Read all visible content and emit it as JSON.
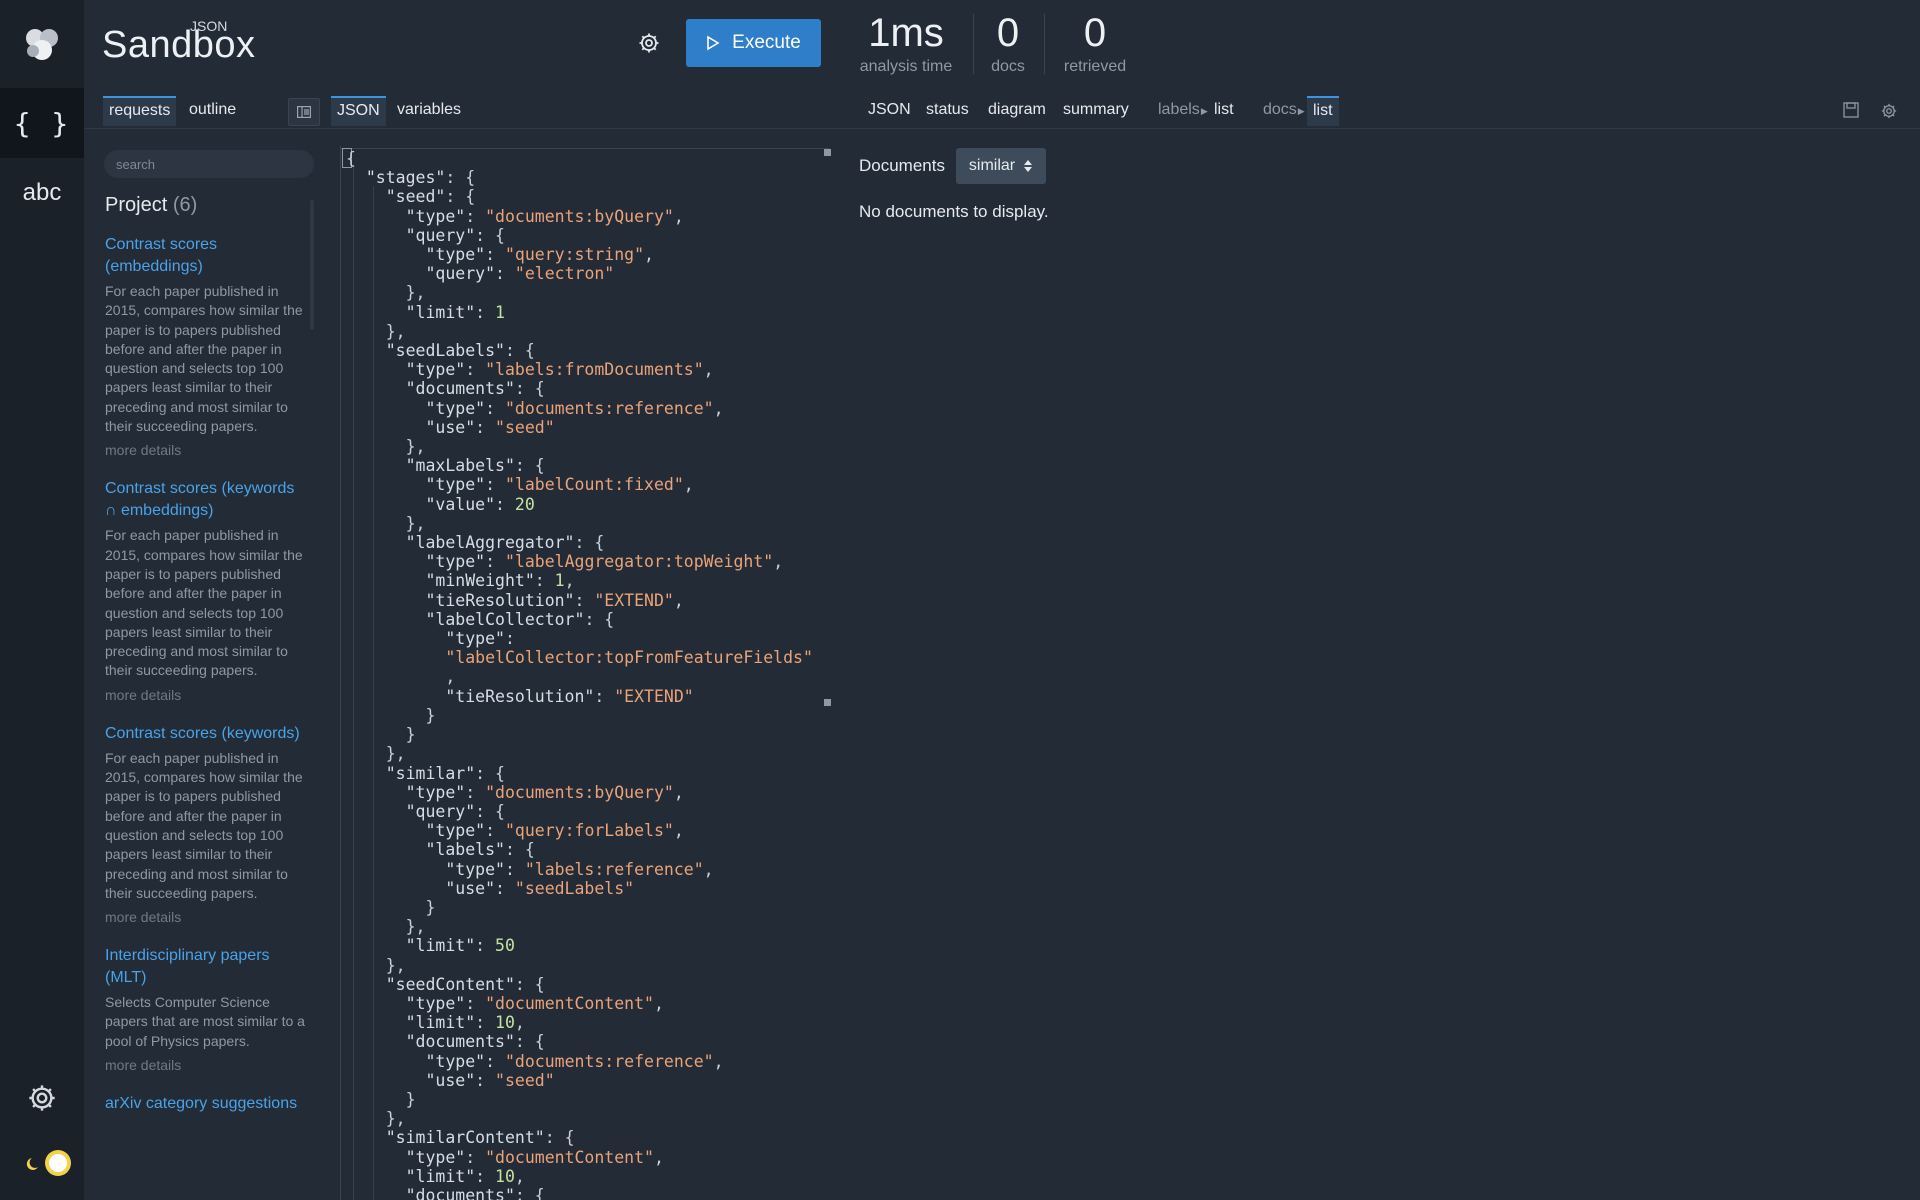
{
  "app": {
    "brand_small": "JSON",
    "brand_big": "Sandbox",
    "execute_label": "Execute"
  },
  "stats": [
    {
      "value": "1ms",
      "label": "analysis time"
    },
    {
      "value": "0",
      "label": "docs"
    },
    {
      "value": "0",
      "label": "retrieved"
    }
  ],
  "left_tabs": {
    "requests": "requests",
    "outline": "outline"
  },
  "editor_tabs": {
    "json": "JSON",
    "variables": "variables"
  },
  "result_tabs": {
    "json": "JSON",
    "status": "status",
    "diagram": "diagram",
    "summary": "summary",
    "labels": "labels",
    "labels_list": "list",
    "docs": "docs",
    "docs_list": "list"
  },
  "rail": {
    "json_icon": "{ }",
    "abc": "abc"
  },
  "sidebar": {
    "search_placeholder": "search",
    "project_title": "Project",
    "project_count": "(6)",
    "items": [
      {
        "title": "Contrast scores (embeddings)",
        "desc": "For each paper published in 2015, compares how similar the paper is to papers published before and after the paper in question and selects top 100 papers least similar to their preceding and most similar to their succeeding papers.",
        "more": "more details"
      },
      {
        "title": "Contrast scores (keywords ∩ embeddings)",
        "desc": "For each paper published in 2015, compares how similar the paper is to papers published before and after the paper in question and selects top 100 papers least similar to their preceding and most similar to their succeeding papers.",
        "more": "more details"
      },
      {
        "title": "Contrast scores (keywords)",
        "desc": "For each paper published in 2015, compares how similar the paper is to papers published before and after the paper in question and selects top 100 papers least similar to their preceding and most similar to their succeeding papers.",
        "more": "more details"
      },
      {
        "title": "Interdisciplinary papers (MLT)",
        "desc": "Selects Computer Science papers that are most similar to a pool of Physics papers.",
        "more": "more details"
      },
      {
        "title": "arXiv category suggestions",
        "desc": "",
        "more": ""
      }
    ]
  },
  "documents": {
    "label": "Documents",
    "select_value": "similar",
    "empty_message": "No documents to display."
  },
  "editor": {
    "code": "{\n  \"stages\": {\n    \"seed\": {\n      \"type\": \"documents:byQuery\",\n      \"query\": {\n        \"type\": \"query:string\",\n        \"query\": \"electron\"\n      },\n      \"limit\": 1\n    },\n    \"seedLabels\": {\n      \"type\": \"labels:fromDocuments\",\n      \"documents\": {\n        \"type\": \"documents:reference\",\n        \"use\": \"seed\"\n      },\n      \"maxLabels\": {\n        \"type\": \"labelCount:fixed\",\n        \"value\": 20\n      },\n      \"labelAggregator\": {\n        \"type\": \"labelAggregator:topWeight\",\n        \"minWeight\": 1,\n        \"tieResolution\": \"EXTEND\",\n        \"labelCollector\": {\n          \"type\":\n          \"labelCollector:topFromFeatureFields\"\n          ,\n          \"tieResolution\": \"EXTEND\"\n        }\n      }\n    },\n    \"similar\": {\n      \"type\": \"documents:byQuery\",\n      \"query\": {\n        \"type\": \"query:forLabels\",\n        \"labels\": {\n          \"type\": \"labels:reference\",\n          \"use\": \"seedLabels\"\n        }\n      },\n      \"limit\": 50\n    },\n    \"seedContent\": {\n      \"type\": \"documentContent\",\n      \"limit\": 10,\n      \"documents\": {\n        \"type\": \"documents:reference\",\n        \"use\": \"seed\"\n      }\n    },\n    \"similarContent\": {\n      \"type\": \"documentContent\",\n      \"limit\": 10,\n      \"documents\": {"
  },
  "colors": {
    "accent": "#2e7ec9",
    "link": "#4aa2e8",
    "json_key": "#d6dde5",
    "json_string": "#e9a37a",
    "json_number": "#c3e2a4",
    "background": "#232b36"
  },
  "icons": {
    "logo": "clustered-circles-logo",
    "rail_gear": "gear-icon",
    "theme": "moon-sun-toggle-icon",
    "header_gear": "gear-icon",
    "execute": "play-icon",
    "layout_toggle": "panel-toggle-icon",
    "save": "save-icon",
    "settings": "gear-icon",
    "select": "sort-arrows-icon"
  }
}
